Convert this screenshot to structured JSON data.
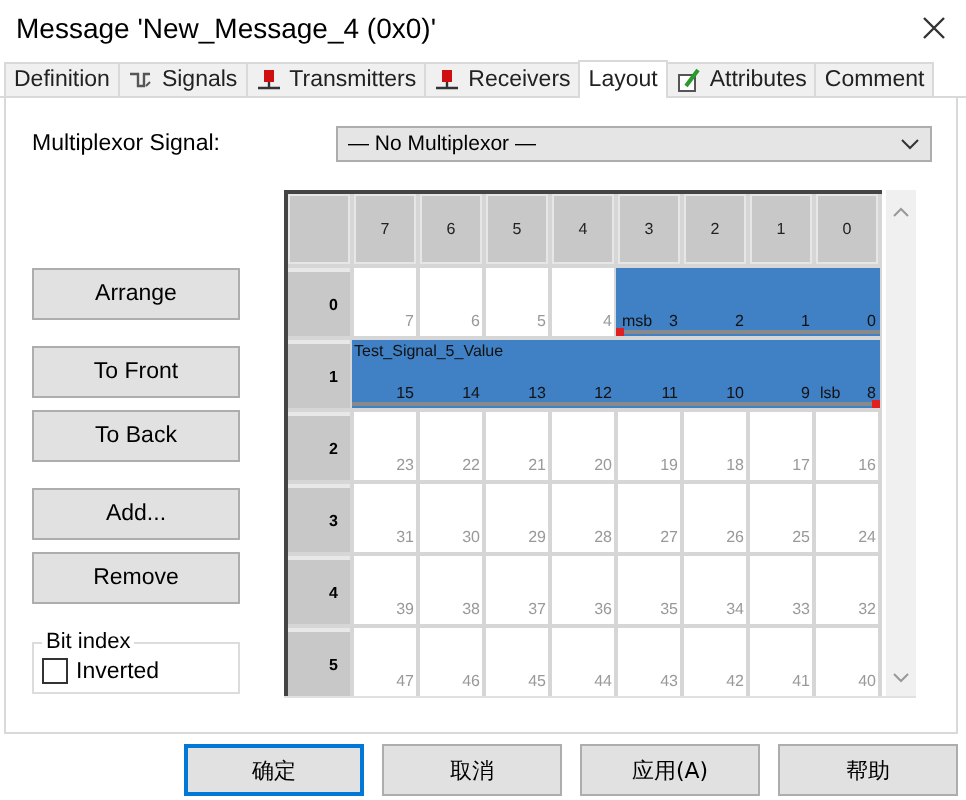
{
  "window": {
    "title": "Message 'New_Message_4 (0x0)'"
  },
  "tabs": [
    {
      "label": "Definition",
      "selected": false,
      "kind": "plain"
    },
    {
      "label": "Signals",
      "selected": false,
      "kind": "signal"
    },
    {
      "label": "Transmitters",
      "selected": false,
      "kind": "node"
    },
    {
      "label": "Receivers",
      "selected": false,
      "kind": "node"
    },
    {
      "label": "Layout",
      "selected": true,
      "kind": "plain"
    },
    {
      "label": "Attributes",
      "selected": false,
      "kind": "attribute"
    },
    {
      "label": "Comment",
      "selected": false,
      "kind": "plain"
    }
  ],
  "multiplexor": {
    "label": "Multiplexor Signal:",
    "value": "— No Multiplexor —"
  },
  "action_groups": [
    [
      "Arrange"
    ],
    [
      "To Front",
      "To Back"
    ],
    [
      "Add...",
      "Remove"
    ]
  ],
  "bit_index": {
    "title": "Bit index",
    "option": {
      "label": "Inverted",
      "checked": false
    }
  },
  "grid": {
    "columns": [
      "7",
      "6",
      "5",
      "4",
      "3",
      "2",
      "1",
      "0"
    ],
    "rows": [
      {
        "label": "0",
        "cells": [
          {
            "bit": "7",
            "in_signal": false
          },
          {
            "bit": "6",
            "in_signal": false
          },
          {
            "bit": "5",
            "in_signal": false
          },
          {
            "bit": "4",
            "in_signal": false
          },
          {
            "bit": "3",
            "in_signal": true,
            "tag": "msb",
            "start_marker": true
          },
          {
            "bit": "2",
            "in_signal": true
          },
          {
            "bit": "1",
            "in_signal": true
          },
          {
            "bit": "0",
            "in_signal": true
          }
        ]
      },
      {
        "label": "1",
        "signal_name": "Test_Signal_5_Value",
        "cells": [
          {
            "bit": "15",
            "in_signal": true
          },
          {
            "bit": "14",
            "in_signal": true
          },
          {
            "bit": "13",
            "in_signal": true
          },
          {
            "bit": "12",
            "in_signal": true
          },
          {
            "bit": "11",
            "in_signal": true
          },
          {
            "bit": "10",
            "in_signal": true
          },
          {
            "bit": "9",
            "in_signal": true
          },
          {
            "bit": "8",
            "in_signal": true,
            "tag": "lsb",
            "end_marker": true
          }
        ]
      },
      {
        "label": "2",
        "cells": [
          {
            "bit": "23",
            "in_signal": false
          },
          {
            "bit": "22",
            "in_signal": false
          },
          {
            "bit": "21",
            "in_signal": false
          },
          {
            "bit": "20",
            "in_signal": false
          },
          {
            "bit": "19",
            "in_signal": false
          },
          {
            "bit": "18",
            "in_signal": false
          },
          {
            "bit": "17",
            "in_signal": false
          },
          {
            "bit": "16",
            "in_signal": false
          }
        ]
      },
      {
        "label": "3",
        "cells": [
          {
            "bit": "31",
            "in_signal": false
          },
          {
            "bit": "30",
            "in_signal": false
          },
          {
            "bit": "29",
            "in_signal": false
          },
          {
            "bit": "28",
            "in_signal": false
          },
          {
            "bit": "27",
            "in_signal": false
          },
          {
            "bit": "26",
            "in_signal": false
          },
          {
            "bit": "25",
            "in_signal": false
          },
          {
            "bit": "24",
            "in_signal": false
          }
        ]
      },
      {
        "label": "4",
        "cells": [
          {
            "bit": "39",
            "in_signal": false
          },
          {
            "bit": "38",
            "in_signal": false
          },
          {
            "bit": "37",
            "in_signal": false
          },
          {
            "bit": "36",
            "in_signal": false
          },
          {
            "bit": "35",
            "in_signal": false
          },
          {
            "bit": "34",
            "in_signal": false
          },
          {
            "bit": "33",
            "in_signal": false
          },
          {
            "bit": "32",
            "in_signal": false
          }
        ]
      },
      {
        "label": "5",
        "cells": [
          {
            "bit": "47",
            "in_signal": false
          },
          {
            "bit": "46",
            "in_signal": false
          },
          {
            "bit": "45",
            "in_signal": false
          },
          {
            "bit": "44",
            "in_signal": false
          },
          {
            "bit": "43",
            "in_signal": false
          },
          {
            "bit": "42",
            "in_signal": false
          },
          {
            "bit": "41",
            "in_signal": false
          },
          {
            "bit": "40",
            "in_signal": false
          }
        ]
      }
    ]
  },
  "buttons": [
    {
      "label": "确定",
      "focused": true
    },
    {
      "label": "取消",
      "focused": false
    },
    {
      "label": "应用(A)",
      "focused": false
    },
    {
      "label": "帮助",
      "focused": false
    }
  ]
}
